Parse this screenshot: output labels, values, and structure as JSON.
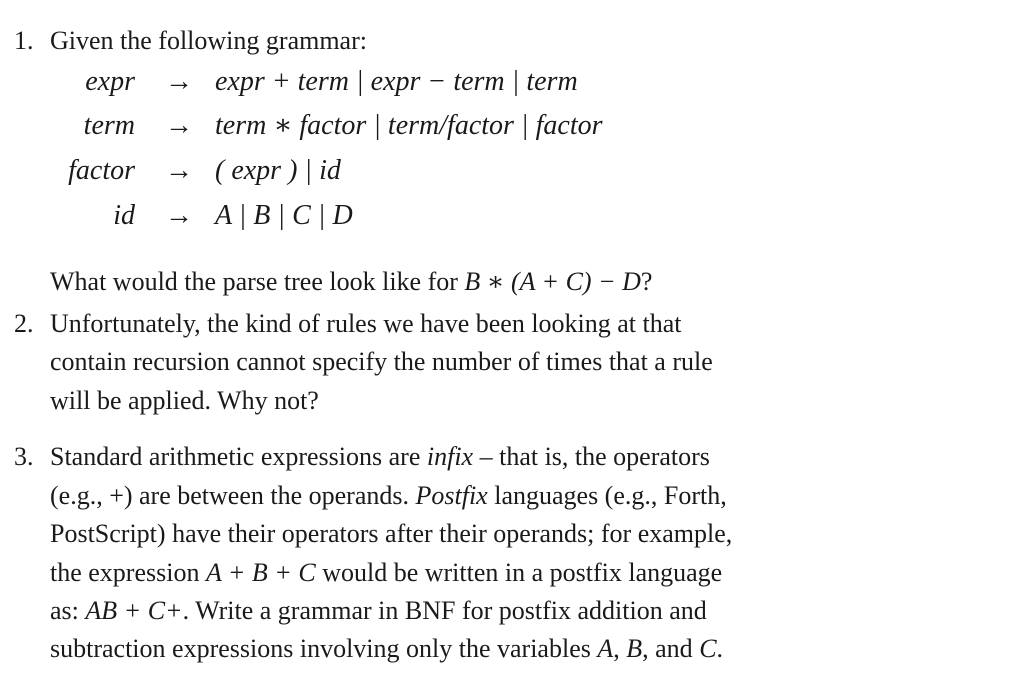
{
  "items": [
    {
      "number": "1.",
      "intro": "Given the following grammar:",
      "grammar": [
        {
          "lhs": "expr",
          "arrow": "→",
          "rhs": "expr + term | expr − term | term"
        },
        {
          "lhs": "term",
          "arrow": "→",
          "rhs": "term ∗ factor | term/factor | factor"
        },
        {
          "lhs": "factor",
          "arrow": "→",
          "rhs": "( expr ) | id"
        },
        {
          "lhs": "id",
          "arrow": "→",
          "rhs": "A | B | C | D"
        }
      ],
      "question_prefix": "What would the parse tree look like for ",
      "question_expr": "B ∗ (A + C) − D",
      "question_suffix": "?"
    },
    {
      "number": "2.",
      "lines": [
        "Unfortunately, the kind of rules we have been looking at that",
        "contain recursion cannot specify the number of times that a rule",
        "will be applied. Why not?"
      ]
    },
    {
      "number": "3.",
      "line1_a": "Standard arithmetic expressions are ",
      "line1_it": "infix",
      "line1_b": " – that is, the operators",
      "line2_a": "(e.g., +) are between the operands. ",
      "line2_it": "Postfix",
      "line2_b": " languages (e.g., Forth,",
      "line3": "PostScript) have their operators after their operands; for example,",
      "line4_a": "the expression ",
      "line4_it": "A + B + C",
      "line4_b": " would be written in a postfix language",
      "line5_a": "as: ",
      "line5_it": "AB + C+",
      "line5_b": ". Write a grammar in BNF for postfix addition and",
      "line6_a": "subtraction expressions involving only the variables ",
      "line6_it1": "A",
      "line6_sep1": ", ",
      "line6_it2": "B",
      "line6_sep2": ", and ",
      "line6_it3": "C",
      "line6_end": "."
    }
  ]
}
